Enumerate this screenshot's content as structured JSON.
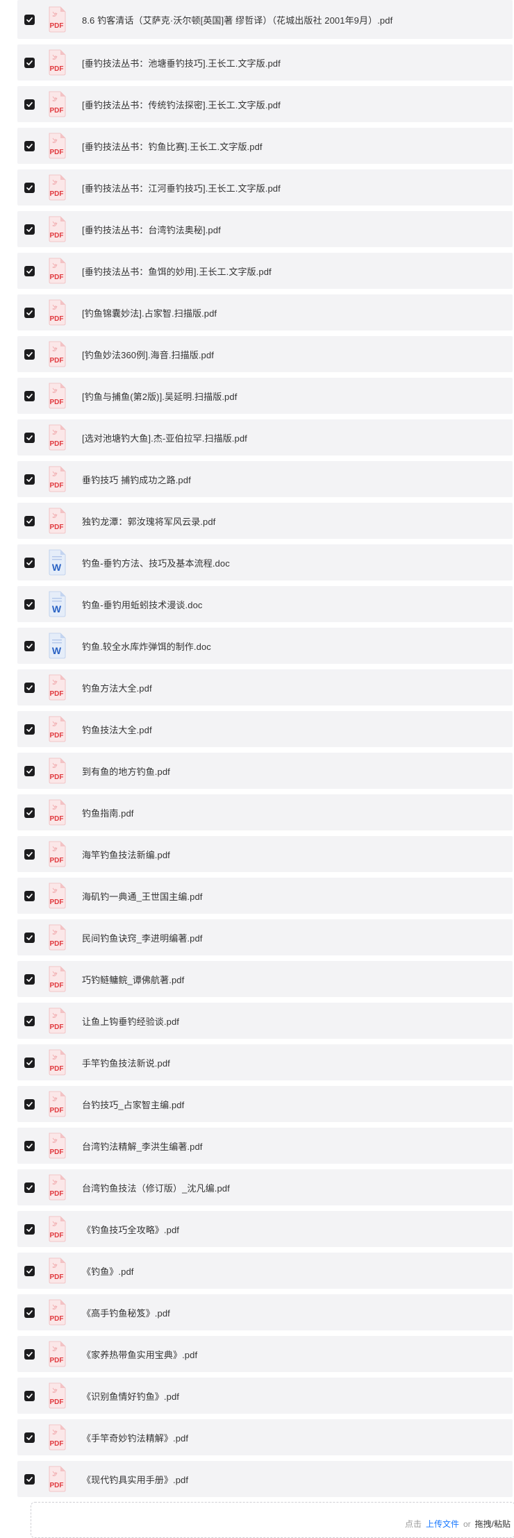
{
  "files": [
    {
      "name": "8.6 钓客清话（艾萨克·沃尔顿[英国]著 缪哲译）（花城出版社 2001年9月）.pdf",
      "type": "pdf",
      "checked": true
    },
    {
      "name": "[垂钓技法丛书：池塘垂钓技巧].王长工.文字版.pdf",
      "type": "pdf",
      "checked": true
    },
    {
      "name": "[垂钓技法丛书：传统钓法探密].王长工.文字版.pdf",
      "type": "pdf",
      "checked": true
    },
    {
      "name": "[垂钓技法丛书：钓鱼比赛].王长工.文字版.pdf",
      "type": "pdf",
      "checked": true
    },
    {
      "name": "[垂钓技法丛书：江河垂钓技巧].王长工.文字版.pdf",
      "type": "pdf",
      "checked": true
    },
    {
      "name": "[垂钓技法丛书：台湾钓法奥秘].pdf",
      "type": "pdf",
      "checked": true
    },
    {
      "name": "[垂钓技法丛书：鱼饵的妙用].王长工.文字版.pdf",
      "type": "pdf",
      "checked": true
    },
    {
      "name": "[钓鱼锦囊妙法].占家智.扫描版.pdf",
      "type": "pdf",
      "checked": true
    },
    {
      "name": "[钓鱼妙法360例].海音.扫描版.pdf",
      "type": "pdf",
      "checked": true
    },
    {
      "name": "[钓鱼与捕鱼(第2版)].吴延明.扫描版.pdf",
      "type": "pdf",
      "checked": true
    },
    {
      "name": "[选对池塘钓大鱼].杰-亚伯拉罕.扫描版.pdf",
      "type": "pdf",
      "checked": true
    },
    {
      "name": "垂钓技巧  捕钓成功之路.pdf",
      "type": "pdf",
      "checked": true
    },
    {
      "name": "独钓龙潭：郭汝瑰将军风云录.pdf",
      "type": "pdf",
      "checked": true
    },
    {
      "name": "钓鱼-垂钓方法、技巧及基本流程.doc",
      "type": "doc",
      "checked": true
    },
    {
      "name": "钓鱼-垂钓用蚯蚓技术漫谈.doc",
      "type": "doc",
      "checked": true
    },
    {
      "name": "钓鱼.较全水库炸弹饵的制作.doc",
      "type": "doc",
      "checked": true
    },
    {
      "name": "钓鱼方法大全.pdf",
      "type": "pdf",
      "checked": true
    },
    {
      "name": "钓鱼技法大全.pdf",
      "type": "pdf",
      "checked": true
    },
    {
      "name": "到有鱼的地方钓鱼.pdf",
      "type": "pdf",
      "checked": true
    },
    {
      "name": "钓鱼指南.pdf",
      "type": "pdf",
      "checked": true
    },
    {
      "name": "海竿钓鱼技法新编.pdf",
      "type": "pdf",
      "checked": true
    },
    {
      "name": "海矶钓一典通_王世国主编.pdf",
      "type": "pdf",
      "checked": true
    },
    {
      "name": "民间钓鱼诀窍_李进明编著.pdf",
      "type": "pdf",
      "checked": true
    },
    {
      "name": "巧钓鲢鳙鲩_谭佛航著.pdf",
      "type": "pdf",
      "checked": true
    },
    {
      "name": "让鱼上钩垂钓经验谈.pdf",
      "type": "pdf",
      "checked": true
    },
    {
      "name": "手竿钓鱼技法新说.pdf",
      "type": "pdf",
      "checked": true
    },
    {
      "name": "台钓技巧_占家智主编.pdf",
      "type": "pdf",
      "checked": true
    },
    {
      "name": "台湾钓法精解_李洪生编著.pdf",
      "type": "pdf",
      "checked": true
    },
    {
      "name": "台湾钓鱼技法（修订版）_沈凡编.pdf",
      "type": "pdf",
      "checked": true
    },
    {
      "name": "《钓鱼技巧全攻略》.pdf",
      "type": "pdf",
      "checked": true
    },
    {
      "name": "《钓鱼》.pdf",
      "type": "pdf",
      "checked": true
    },
    {
      "name": "《高手钓鱼秘笈》.pdf",
      "type": "pdf",
      "checked": true
    },
    {
      "name": "《家养热带鱼实用宝典》.pdf",
      "type": "pdf",
      "checked": true
    },
    {
      "name": "《识别鱼情好钓鱼》.pdf",
      "type": "pdf",
      "checked": true
    },
    {
      "name": "《手竿奇妙钓法精解》.pdf",
      "type": "pdf",
      "checked": true
    },
    {
      "name": "《现代钓具实用手册》.pdf",
      "type": "pdf",
      "checked": true
    }
  ],
  "icons": {
    "pdf": "pdf-icon",
    "doc": "word-icon",
    "checkbox": "checkmark-icon"
  },
  "icon_labels": {
    "pdf": "PDF",
    "doc": "W"
  },
  "upload": {
    "click_label": "点击",
    "upload_link": "上传文件",
    "or_label": "or",
    "drag_label": "拖拽/粘贴"
  },
  "colors": {
    "checkbox": "#1d1d1f",
    "pdf_red": "#e0393e",
    "word_blue": "#2b63c4",
    "link": "#1677ff",
    "row_bg": "#f3f3f5"
  }
}
